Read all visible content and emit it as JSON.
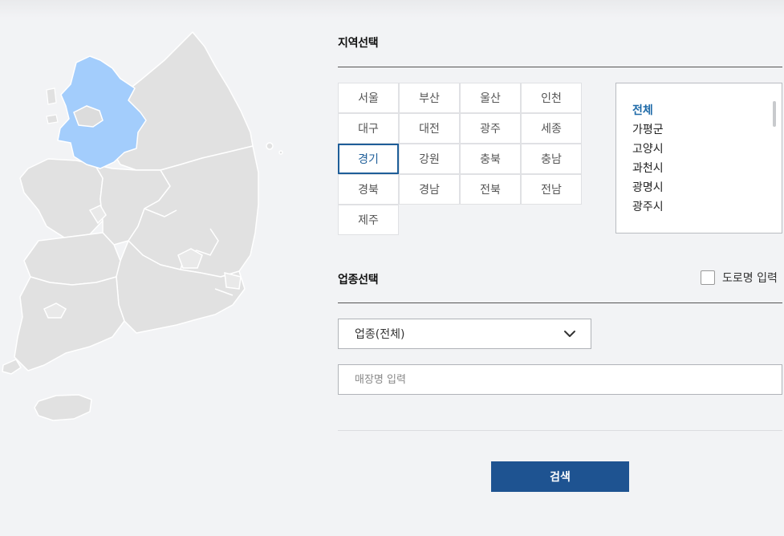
{
  "region_section": {
    "title": "지역선택",
    "regions": [
      "서울",
      "부산",
      "울산",
      "인천",
      "대구",
      "대전",
      "광주",
      "세종",
      "경기",
      "강원",
      "충북",
      "충남",
      "경북",
      "경남",
      "전북",
      "전남",
      "제주"
    ],
    "selected": "경기"
  },
  "district_list": {
    "items": [
      "전체",
      "가평군",
      "고양시",
      "과천시",
      "광명시",
      "광주시"
    ],
    "selected": "전체"
  },
  "business_section": {
    "title": "업종선택",
    "road_name_label": "도로명 입력",
    "business_select_value": "업종(전체)",
    "store_name_placeholder": "매장명 입력"
  },
  "search_button_label": "검색",
  "colors": {
    "accent": "#1e5e99",
    "button": "#1e5391",
    "map_selected": "#a3cdfc",
    "map_base": "#e1e1e1"
  },
  "icons": {
    "select_arrow": "chevron-down-icon"
  }
}
